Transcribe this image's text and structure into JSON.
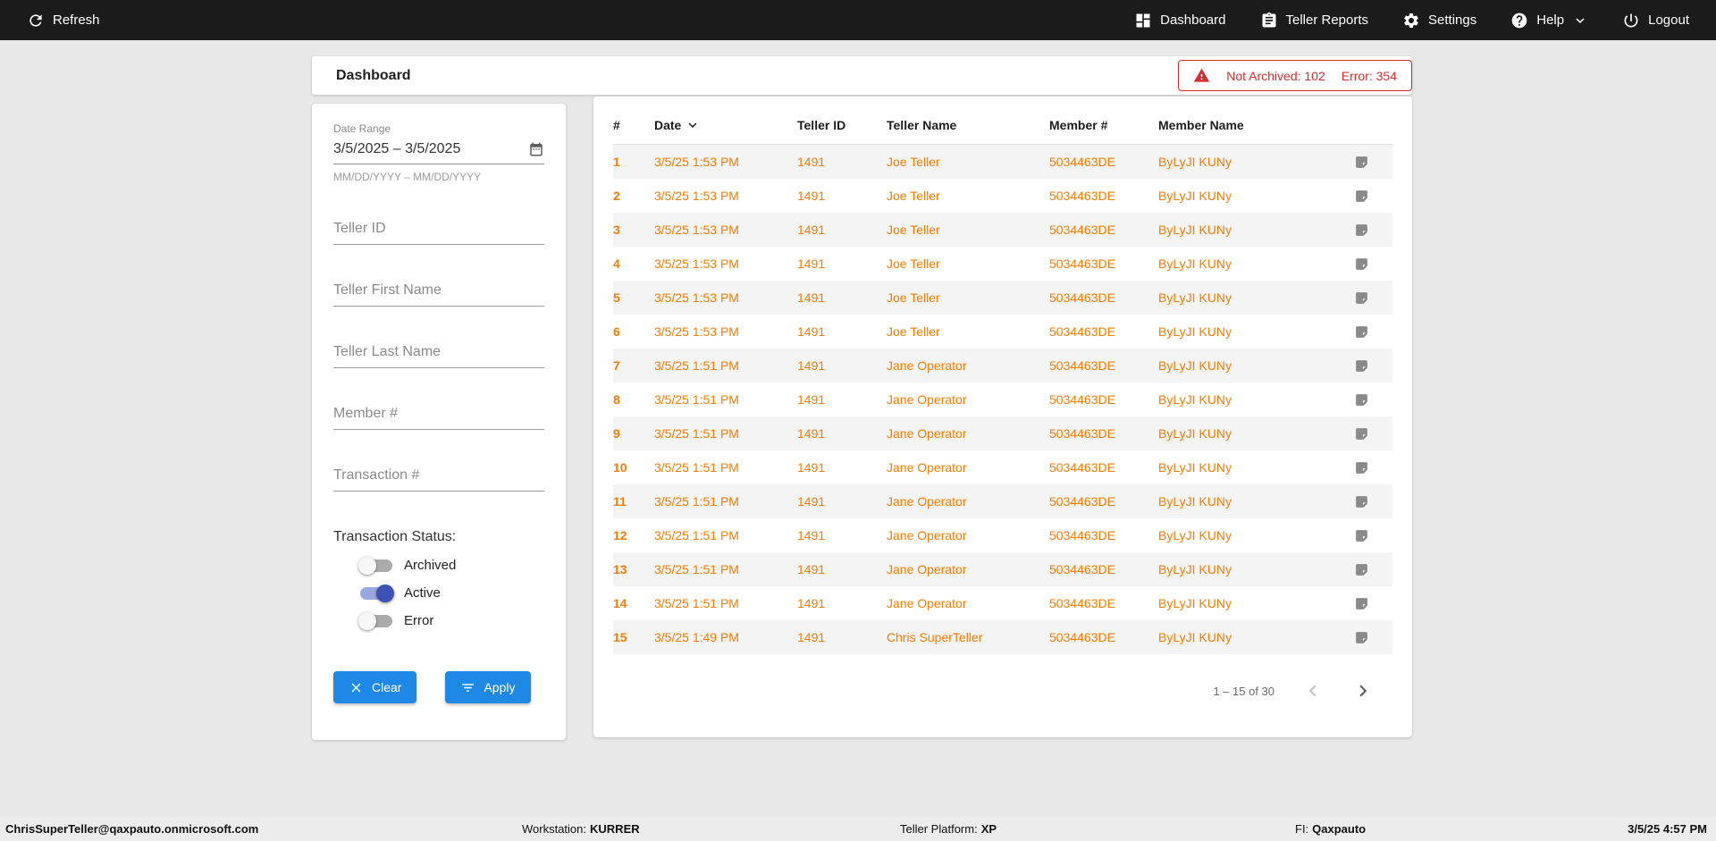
{
  "topbar": {
    "refresh": {
      "label": "Refresh",
      "icon": "refresh-icon"
    },
    "nav": [
      {
        "label": "Dashboard",
        "icon": "dashboard-icon"
      },
      {
        "label": "Teller Reports",
        "icon": "clipboard-icon"
      },
      {
        "label": "Settings",
        "icon": "gear-icon"
      },
      {
        "label": "Help",
        "icon": "help-icon",
        "has_dropdown": true
      },
      {
        "label": "Logout",
        "icon": "power-icon"
      }
    ]
  },
  "header": {
    "title": "Dashboard",
    "alert": {
      "not_archived": "Not Archived: 102",
      "error": "Error: 354",
      "color": "#d32f2f",
      "icon": "warning-icon"
    }
  },
  "filters": {
    "date_range": {
      "label": "Date Range",
      "value": "3/5/2025 – 3/5/2025",
      "hint": "MM/DD/YYYY – MM/DD/YYYY",
      "icon": "calendar-icon"
    },
    "fields": [
      {
        "placeholder": "Teller ID"
      },
      {
        "placeholder": "Teller First Name"
      },
      {
        "placeholder": "Teller Last Name"
      },
      {
        "placeholder": "Member #"
      },
      {
        "placeholder": "Transaction #"
      }
    ],
    "status_label": "Transaction Status:",
    "toggles": [
      {
        "label": "Archived",
        "on": false
      },
      {
        "label": "Active",
        "on": true
      },
      {
        "label": "Error",
        "on": false
      }
    ],
    "buttons": {
      "clear": "Clear",
      "apply": "Apply"
    },
    "accent_color": "#1e88e5",
    "toggle_on_color": "#3f51b5"
  },
  "table": {
    "columns": [
      "#",
      "Date",
      "Teller ID",
      "Teller Name",
      "Member #",
      "Member Name"
    ],
    "sorted_column": "Date",
    "sort_direction": "desc",
    "text_color": "#f57c00",
    "rows": [
      {
        "num": "1",
        "date": "3/5/25 1:53 PM",
        "teller_id": "1491",
        "teller_name": "Joe Teller",
        "member_num": "5034463DE",
        "member_name": "ByLyJI KUNy"
      },
      {
        "num": "2",
        "date": "3/5/25 1:53 PM",
        "teller_id": "1491",
        "teller_name": "Joe Teller",
        "member_num": "5034463DE",
        "member_name": "ByLyJI KUNy"
      },
      {
        "num": "3",
        "date": "3/5/25 1:53 PM",
        "teller_id": "1491",
        "teller_name": "Joe Teller",
        "member_num": "5034463DE",
        "member_name": "ByLyJI KUNy"
      },
      {
        "num": "4",
        "date": "3/5/25 1:53 PM",
        "teller_id": "1491",
        "teller_name": "Joe Teller",
        "member_num": "5034463DE",
        "member_name": "ByLyJI KUNy"
      },
      {
        "num": "5",
        "date": "3/5/25 1:53 PM",
        "teller_id": "1491",
        "teller_name": "Joe Teller",
        "member_num": "5034463DE",
        "member_name": "ByLyJI KUNy"
      },
      {
        "num": "6",
        "date": "3/5/25 1:53 PM",
        "teller_id": "1491",
        "teller_name": "Joe Teller",
        "member_num": "5034463DE",
        "member_name": "ByLyJI KUNy"
      },
      {
        "num": "7",
        "date": "3/5/25 1:51 PM",
        "teller_id": "1491",
        "teller_name": "Jane Operator",
        "member_num": "5034463DE",
        "member_name": "ByLyJI KUNy"
      },
      {
        "num": "8",
        "date": "3/5/25 1:51 PM",
        "teller_id": "1491",
        "teller_name": "Jane Operator",
        "member_num": "5034463DE",
        "member_name": "ByLyJI KUNy"
      },
      {
        "num": "9",
        "date": "3/5/25 1:51 PM",
        "teller_id": "1491",
        "teller_name": "Jane Operator",
        "member_num": "5034463DE",
        "member_name": "ByLyJI KUNy"
      },
      {
        "num": "10",
        "date": "3/5/25 1:51 PM",
        "teller_id": "1491",
        "teller_name": "Jane Operator",
        "member_num": "5034463DE",
        "member_name": "ByLyJI KUNy"
      },
      {
        "num": "11",
        "date": "3/5/25 1:51 PM",
        "teller_id": "1491",
        "teller_name": "Jane Operator",
        "member_num": "5034463DE",
        "member_name": "ByLyJI KUNy"
      },
      {
        "num": "12",
        "date": "3/5/25 1:51 PM",
        "teller_id": "1491",
        "teller_name": "Jane Operator",
        "member_num": "5034463DE",
        "member_name": "ByLyJI KUNy"
      },
      {
        "num": "13",
        "date": "3/5/25 1:51 PM",
        "teller_id": "1491",
        "teller_name": "Jane Operator",
        "member_num": "5034463DE",
        "member_name": "ByLyJI KUNy"
      },
      {
        "num": "14",
        "date": "3/5/25 1:51 PM",
        "teller_id": "1491",
        "teller_name": "Jane Operator",
        "member_num": "5034463DE",
        "member_name": "ByLyJI KUNy"
      },
      {
        "num": "15",
        "date": "3/5/25 1:49 PM",
        "teller_id": "1491",
        "teller_name": "Chris SuperTeller",
        "member_num": "5034463DE",
        "member_name": "ByLyJI KUNy"
      }
    ],
    "row_icon": "note-icon",
    "pagination": {
      "range": "1 – 15 of 30"
    }
  },
  "footer": {
    "email": "ChrisSuperTeller@qaxpauto.onmicrosoft.com",
    "workstation_label": "Workstation:",
    "workstation_value": "KURRER",
    "platform_label": "Teller Platform:",
    "platform_value": "XP",
    "fi_label": "FI:",
    "fi_value": "Qaxpauto",
    "datetime": "3/5/25 4:57 PM"
  }
}
